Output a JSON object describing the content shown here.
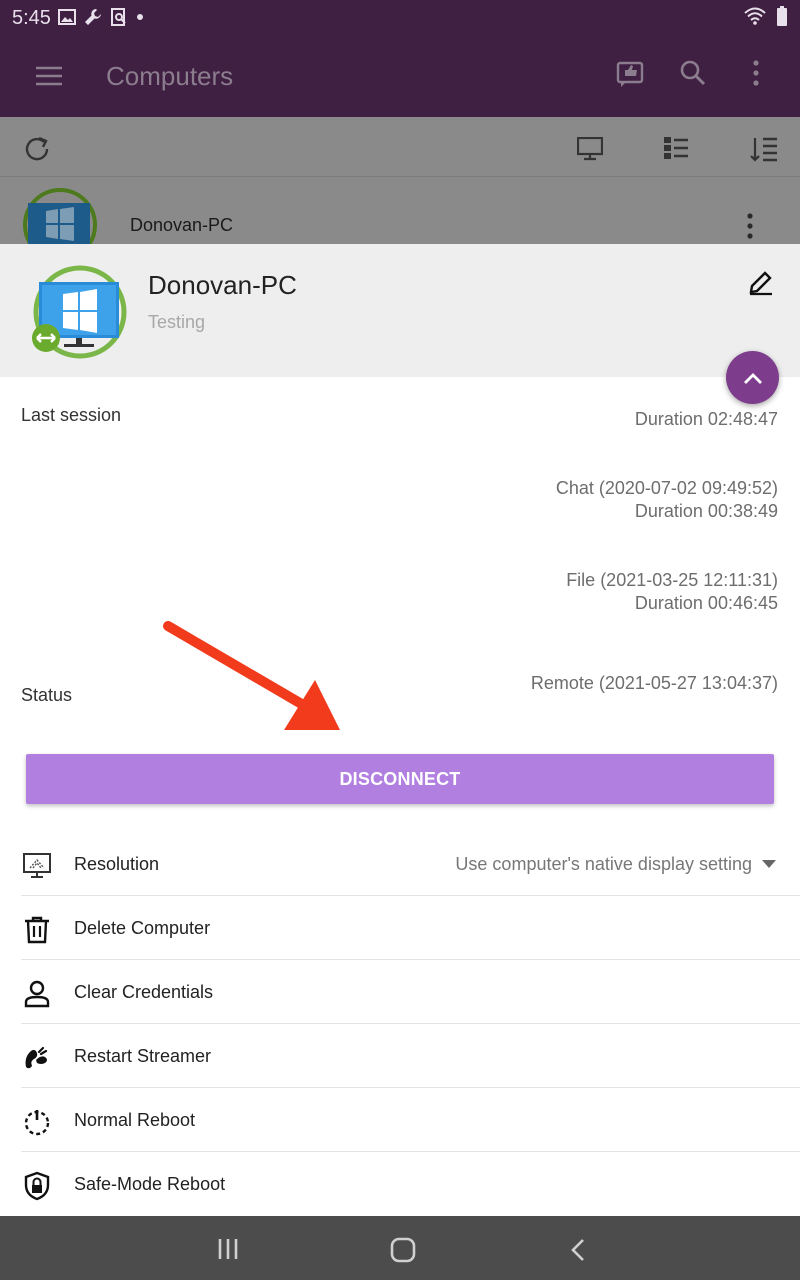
{
  "status_bar": {
    "time": "5:45"
  },
  "app_bar": {
    "title": "Computers"
  },
  "list": {
    "computer_name": "Donovan-PC"
  },
  "sheet": {
    "name": "Donovan-PC",
    "description": "Testing",
    "last_session_label": "Last session",
    "status_label": "Status",
    "sessions": [
      {
        "line1": "",
        "line2": "Duration 02:48:47"
      },
      {
        "line1": "Chat (2020-07-02 09:49:52)",
        "line2": "Duration 00:38:49"
      },
      {
        "line1": "File (2021-03-25 12:11:31)",
        "line2": "Duration 00:46:45"
      },
      {
        "line1": "Remote (2021-05-27 13:04:37)",
        "line2": ""
      }
    ],
    "disconnect_label": "DISCONNECT"
  },
  "menu": {
    "resolution_label": "Resolution",
    "resolution_value": "Use computer's native display setting",
    "items": [
      {
        "label": "Delete Computer",
        "icon": "trash-icon"
      },
      {
        "label": "Clear Credentials",
        "icon": "person-icon"
      },
      {
        "label": "Restart Streamer",
        "icon": "streamer-icon"
      },
      {
        "label": "Normal Reboot",
        "icon": "power-icon"
      },
      {
        "label": "Safe-Mode Reboot",
        "icon": "shield-lock-icon"
      }
    ]
  },
  "colors": {
    "app_bar": "#3f1f42",
    "accent_purple": "#7d3c8c",
    "button_purple": "#b07fe0",
    "arrow_red": "#f23a1d"
  }
}
